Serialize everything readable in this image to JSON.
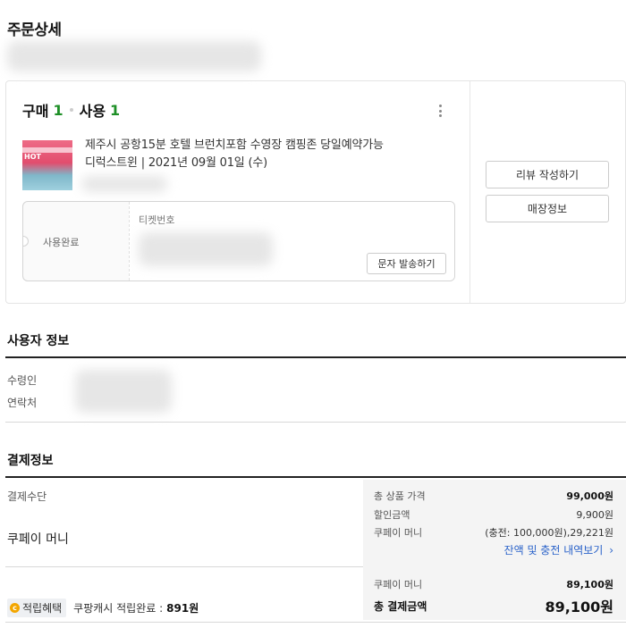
{
  "page": {
    "title": "주문상세"
  },
  "order": {
    "buy_label": "구매",
    "buy_count": "1",
    "use_label": "사용",
    "use_count": "1",
    "product_name": "제주시 공항15분 호텔 브런치포함 수영장 캠핑존 당일예약가능",
    "product_option": "디럭스트윈 | 2021년 09월 01일 (수)",
    "thumbnail_text": [
      "HOT",
      "",
      ""
    ]
  },
  "ticket": {
    "status": "사용완료",
    "number_label": "티켓번호",
    "sms_button": "문자 발송하기"
  },
  "actions": {
    "review_button": "리뷰 작성하기",
    "store_info_button": "매장정보"
  },
  "user_info": {
    "title": "사용자 정보",
    "recipient_label": "수령인",
    "contact_label": "연락처"
  },
  "payment": {
    "title": "결제정보",
    "method_label": "결제수단",
    "method_value": "쿠페이 머니",
    "rows": [
      {
        "label": "총 상품 가격",
        "value": "99,000원"
      },
      {
        "label": "할인금액",
        "value": "9,900원"
      },
      {
        "label": "쿠페이 머니",
        "value": "(충전: 100,000원),29,221원"
      }
    ],
    "history_link": "잔액 및 충전 내역보기",
    "coupay_label": "쿠페이 머니",
    "coupay_value": "89,100원",
    "total_label": "총 결제금액",
    "total_value": "89,100원"
  },
  "reward": {
    "badge_label": "적립혜택",
    "text": "쿠팡캐시 적립완료 :",
    "amount": "891원"
  }
}
